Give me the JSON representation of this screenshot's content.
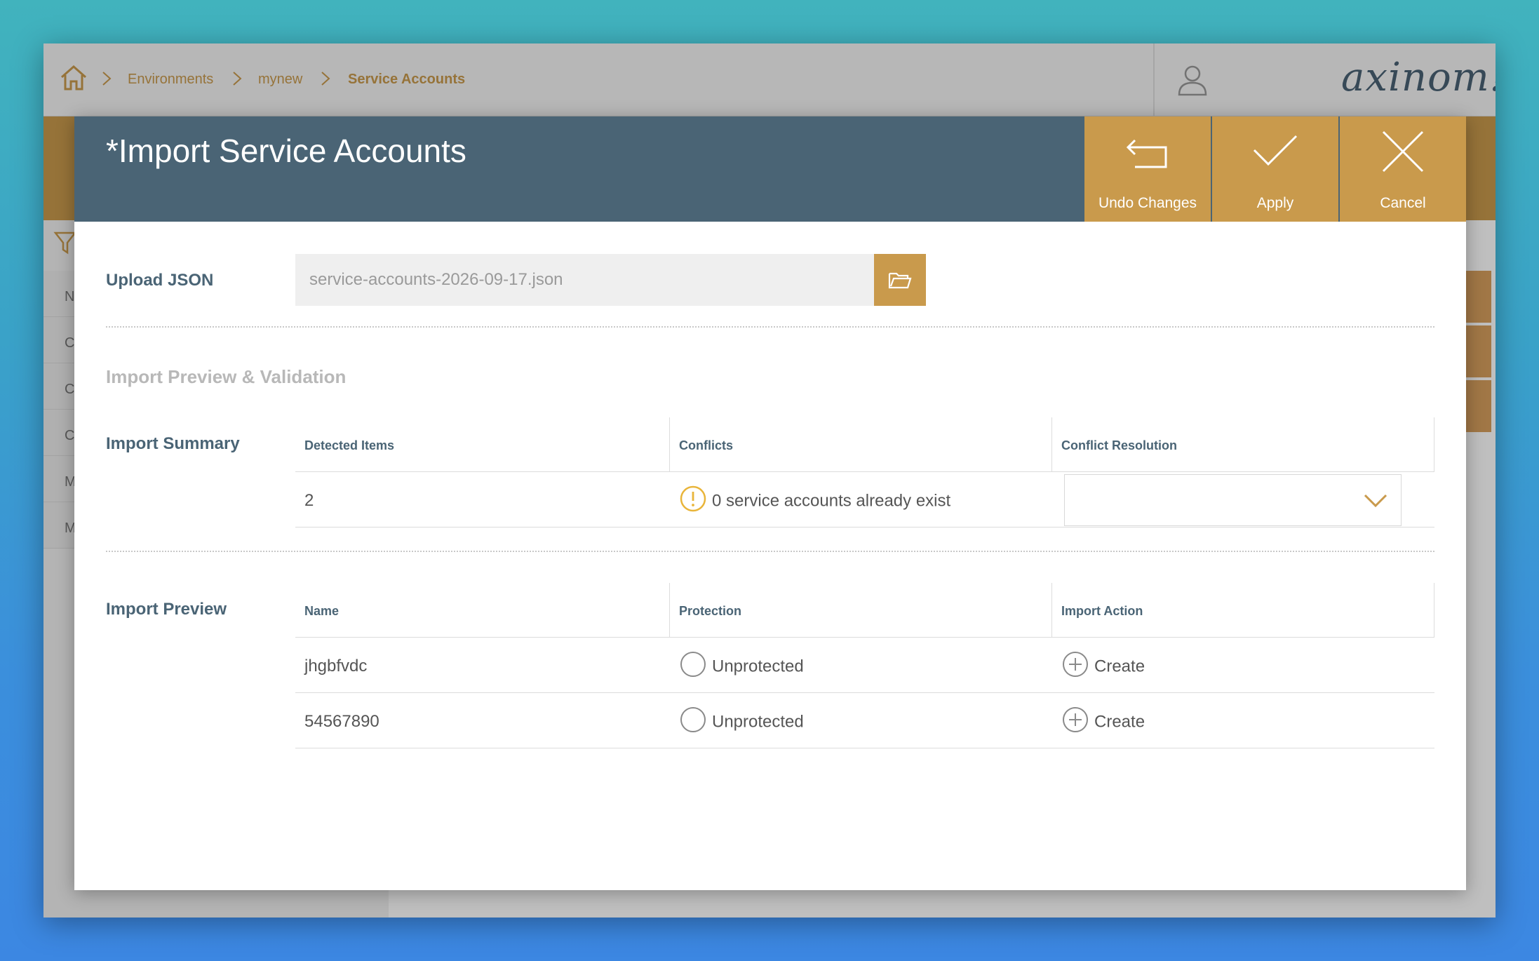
{
  "background_app": {
    "breadcrumb": [
      "Environments",
      "mynew",
      "Service Accounts"
    ],
    "brand": "axinom!",
    "side_items": [
      "N",
      "C",
      "C",
      "C",
      "M",
      "M"
    ]
  },
  "modal": {
    "title": "*Import Service Accounts",
    "actions": {
      "undo": "Undo Changes",
      "apply": "Apply",
      "cancel": "Cancel"
    },
    "upload": {
      "label": "Upload JSON",
      "filename": "service-accounts-2026-09-17.json"
    },
    "preview_validation_title": "Import Preview & Validation",
    "summary": {
      "label": "Import Summary",
      "columns": [
        "Detected Items",
        "Conflicts",
        "Conflict Resolution"
      ],
      "detected_items": "2",
      "conflicts_text": "0 service accounts already exist",
      "conflict_resolution_value": ""
    },
    "preview": {
      "label": "Import Preview",
      "columns": [
        "Name",
        "Protection",
        "Import Action"
      ],
      "rows": [
        {
          "name": "jhgbfvdc",
          "protection": "Unprotected",
          "action": "Create"
        },
        {
          "name": "54567890",
          "protection": "Unprotected",
          "action": "Create"
        }
      ]
    }
  },
  "colors": {
    "header": "#4a6475",
    "accent": "#c99a4c",
    "warning": "#e9b53a"
  }
}
